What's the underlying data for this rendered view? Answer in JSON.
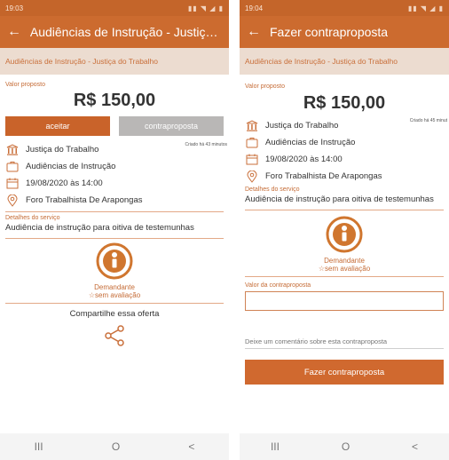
{
  "left": {
    "status_time": "19:03",
    "title": "Audiências de Instrução - Justiça...",
    "breadcrumb": "Audiências de Instrução - Justiça do Trabalho",
    "price_label": "Valor proposto",
    "price": "R$ 150,00",
    "accept_label": "aceitar",
    "counter_label": "contraproposta",
    "created": "Criado há 43 minutos",
    "info": {
      "court": "Justiça do Trabalho",
      "type": "Audiências de Instrução",
      "date": "19/08/2020 às 14:00",
      "place": "Foro Trabalhista De Arapongas"
    },
    "details_label": "Detalhes do serviço",
    "details_text": "Audiência de instrução para oitiva de testemunhas",
    "role": "Demandante",
    "rating": "☆sem avaliação",
    "share_title": "Compartilhe essa oferta"
  },
  "right": {
    "status_time": "19:04",
    "title": "Fazer contraproposta",
    "breadcrumb": "Audiências de Instrução - Justiça do Trabalho",
    "price_label": "Valor proposto",
    "price": "R$ 150,00",
    "created": "Criado há 45 minut",
    "info": {
      "court": "Justiça do Trabalho",
      "type": "Audiências de Instrução",
      "date": "19/08/2020 às 14:00",
      "place": "Foro Trabalhista De Arapongas"
    },
    "details_label": "Detalhes do serviço",
    "details_text": "Audiência de instrução para oitiva de testemunhas",
    "role": "Demandante",
    "rating": "☆sem avaliação",
    "counter_value_label": "Valor da contraproposta",
    "comment_placeholder": "Deixe um comentário sobre esta contraproposta",
    "submit_label": "Fazer contraproposta"
  },
  "nav": {
    "recent": "III",
    "home": "O",
    "back": "<"
  },
  "colors": {
    "primary": "#cc6b2f",
    "accent": "#c96f3a",
    "disabled": "#b9b7b6"
  },
  "icons": [
    "back-arrow-icon",
    "court-icon",
    "briefcase-icon",
    "calendar-icon",
    "location-pin-icon",
    "share-icon",
    "user-logo-icon"
  ]
}
